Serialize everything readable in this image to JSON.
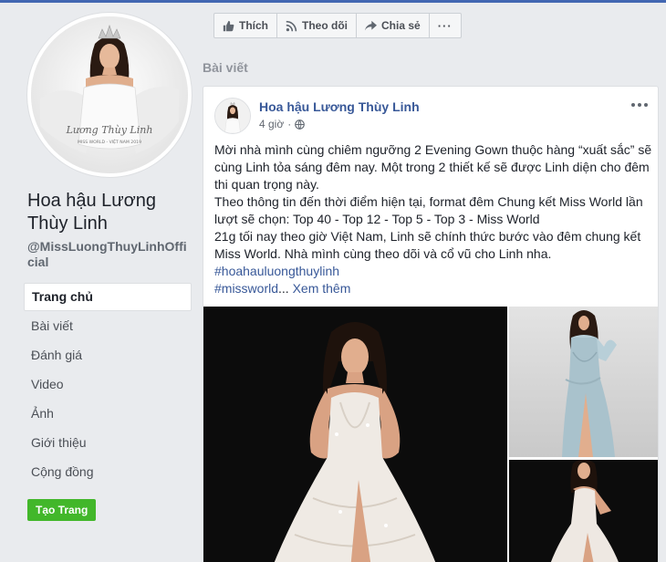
{
  "page": {
    "name": "Hoa hậu Lương Thùy Linh",
    "handle": "@MissLuongThuyLinhOfficial",
    "profile_caption": "Lương Thùy Linh",
    "profile_subcaption": "MISS WORLD - VIỆT NAM 2019"
  },
  "nav": {
    "items": [
      {
        "label": "Trang chủ",
        "active": true
      },
      {
        "label": "Bài viết"
      },
      {
        "label": "Đánh giá"
      },
      {
        "label": "Video"
      },
      {
        "label": "Ảnh"
      },
      {
        "label": "Giới thiệu"
      },
      {
        "label": "Cộng đồng"
      }
    ],
    "create_page": "Tạo Trang"
  },
  "actions": {
    "like": "Thích",
    "follow": "Theo dõi",
    "share": "Chia sẻ",
    "more": "···"
  },
  "section_title": "Bài viết",
  "post": {
    "author": "Hoa hậu Lương Thùy Linh",
    "time": "4 giờ",
    "privacy_icon": "globe-icon",
    "paragraphs": [
      "Mời nhà mình cùng chiêm ngưỡng 2 Evening Gown thuộc hàng “xuất sắc” sẽ cùng Linh tỏa sáng đêm nay. Một trong 2 thiết kế sẽ được Linh diện cho đêm thi quan trọng này.",
      "Theo thông tin đến thời điểm hiện tại, format đêm Chung kết Miss World lần lượt sẽ chọn: Top 40 - Top 12 - Top 5 - Top 3 - Miss World",
      "21g tối nay theo giờ Việt Nam, Linh sẽ chính thức bước vào đêm chung kết Miss World. Nhà mình cùng theo dõi và cổ vũ cho Linh nha."
    ],
    "hashtag1": "#hoahauluongthuylinh",
    "hashtag2": "#missworld",
    "ellipsis": "...",
    "see_more": "Xem thêm"
  },
  "colors": {
    "brand": "#4267b2",
    "link": "#385898",
    "create_button": "#42b72a",
    "background": "#e9ebee"
  }
}
